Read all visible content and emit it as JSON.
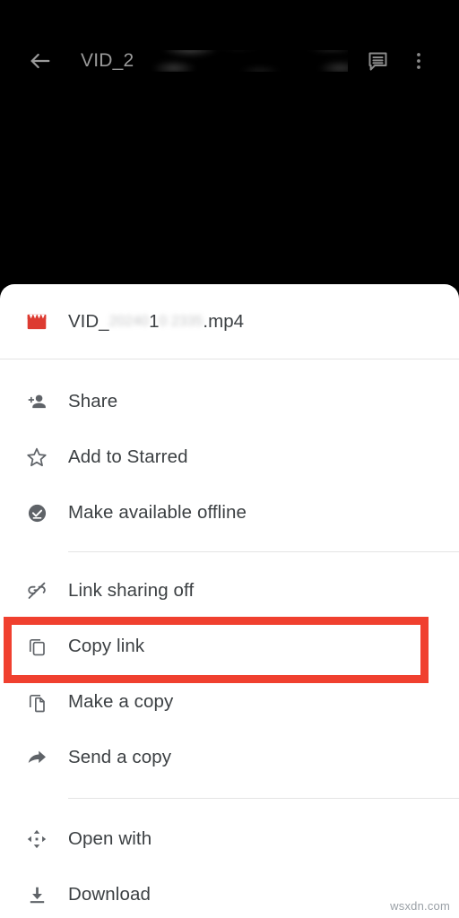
{
  "app": {
    "backdrop_color": "#000000",
    "sheet_color": "#ffffff",
    "accent_red": "#f0402f",
    "icon_color": "#5f6368",
    "text_color": "#3c4043"
  },
  "topbar": {
    "back_icon": "arrow-back-icon",
    "title_visible_prefix": "VID_2",
    "title_redacted_suffix": "                  ",
    "comment_icon": "comment-icon",
    "overflow_icon": "more-vert-icon"
  },
  "sheet": {
    "file": {
      "icon": "video-clapperboard-icon",
      "icon_color": "#dd3b31",
      "name_prefix": "VID_",
      "name_redacted_1": "20240",
      "name_middle": "1",
      "name_redacted_2": "0 2335",
      "name_suffix": ".mp4"
    },
    "groups": [
      {
        "items": [
          {
            "icon": "person-add-icon",
            "label": "Share"
          },
          {
            "icon": "star-outline-icon",
            "label": "Add to Starred"
          },
          {
            "icon": "offline-pin-icon",
            "label": "Make available offline"
          }
        ]
      },
      {
        "items": [
          {
            "icon": "link-off-icon",
            "label": "Link sharing off"
          },
          {
            "icon": "copy-link-icon",
            "label": "Copy link",
            "highlighted": true
          },
          {
            "icon": "file-copy-icon",
            "label": "Make a copy"
          },
          {
            "icon": "send-arrow-icon",
            "label": "Send a copy"
          }
        ]
      },
      {
        "items": [
          {
            "icon": "open-with-icon",
            "label": "Open with"
          },
          {
            "icon": "download-icon",
            "label": "Download"
          }
        ]
      }
    ]
  },
  "annotation": {
    "target_label": "Copy link",
    "box_color": "#f0402f"
  },
  "watermark": {
    "text": "wsxdn.com"
  }
}
